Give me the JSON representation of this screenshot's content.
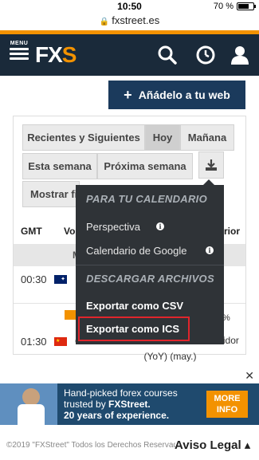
{
  "status_bar": {
    "time": "10:50",
    "battery": "70 %",
    "battery_level": 0.7
  },
  "url_bar": {
    "url": "fxstreet.es"
  },
  "header": {
    "menu_label": "MENU",
    "logo_text": "FX",
    "logo_accent": "S",
    "icons": [
      "search-icon",
      "clock-icon",
      "user-icon"
    ]
  },
  "add_web": {
    "label": "Añádelo a tu web"
  },
  "tabs": {
    "recent_next": "Recientes y Siguientes",
    "today": "Hoy",
    "tomorrow": "Mañana",
    "this_week": "Esta semana",
    "next_week": "Próxima semana",
    "show_filters": "Mostrar fi"
  },
  "calendar": {
    "head_gmt": "GMT",
    "head_vol": "Vo",
    "head_prev": "rior",
    "date_row": "M",
    "events": [
      {
        "time": "00:30",
        "currency": "",
        "name": ""
      },
      {
        "time": "01:30",
        "currency": "CNY",
        "name": "Índice de Precios al Consumidor (YoY) (may.)"
      }
    ],
    "pct": "%"
  },
  "dropdown": {
    "section_calendar": "PARA TU CALENDARIO",
    "perspectiva": "Perspectiva",
    "google": "Calendario de Google",
    "section_download": "DESCARGAR ARCHIVOS",
    "csv": "Exportar como CSV",
    "ics": "Exportar como ICS"
  },
  "ad": {
    "line1": "Hand-picked forex courses",
    "line2_prefix": "trusted by ",
    "line2_brand": "FXStreet.",
    "line3": "20 years of experience.",
    "button": "MORE INFO"
  },
  "footer": {
    "copyright": "©2019 \"FXStreet\" Todos los Derechos Reservados",
    "legal": "Aviso Legal ▴"
  },
  "colors": {
    "orange": "#f39200",
    "navy": "#1a2a3a",
    "button_navy": "#1b3a5c",
    "highlight_red": "#e0252c"
  }
}
